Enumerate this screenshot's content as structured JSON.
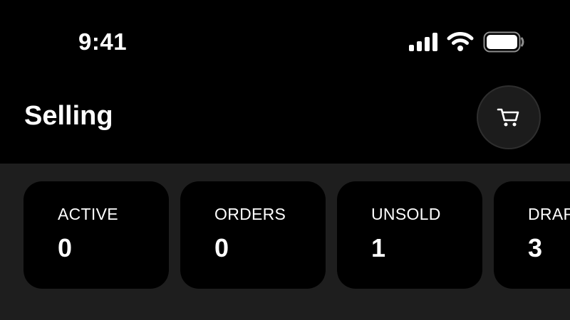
{
  "status_bar": {
    "time": "9:41",
    "icons": [
      "cellular-signal-icon",
      "wifi-icon",
      "battery-icon"
    ]
  },
  "header": {
    "title": "Selling",
    "cart_icon": "shopping-cart-icon"
  },
  "stats": [
    {
      "label": "ACTIVE",
      "value": "0"
    },
    {
      "label": "ORDERS",
      "value": "0"
    },
    {
      "label": "UNSOLD",
      "value": "1"
    },
    {
      "label": "DRAFTS",
      "value": "3"
    }
  ],
  "colors": {
    "background": "#000000",
    "stats_area": "#1e1e1e",
    "card": "#000000",
    "cart_button_bg": "#1c1c1c",
    "text": "#ffffff"
  }
}
